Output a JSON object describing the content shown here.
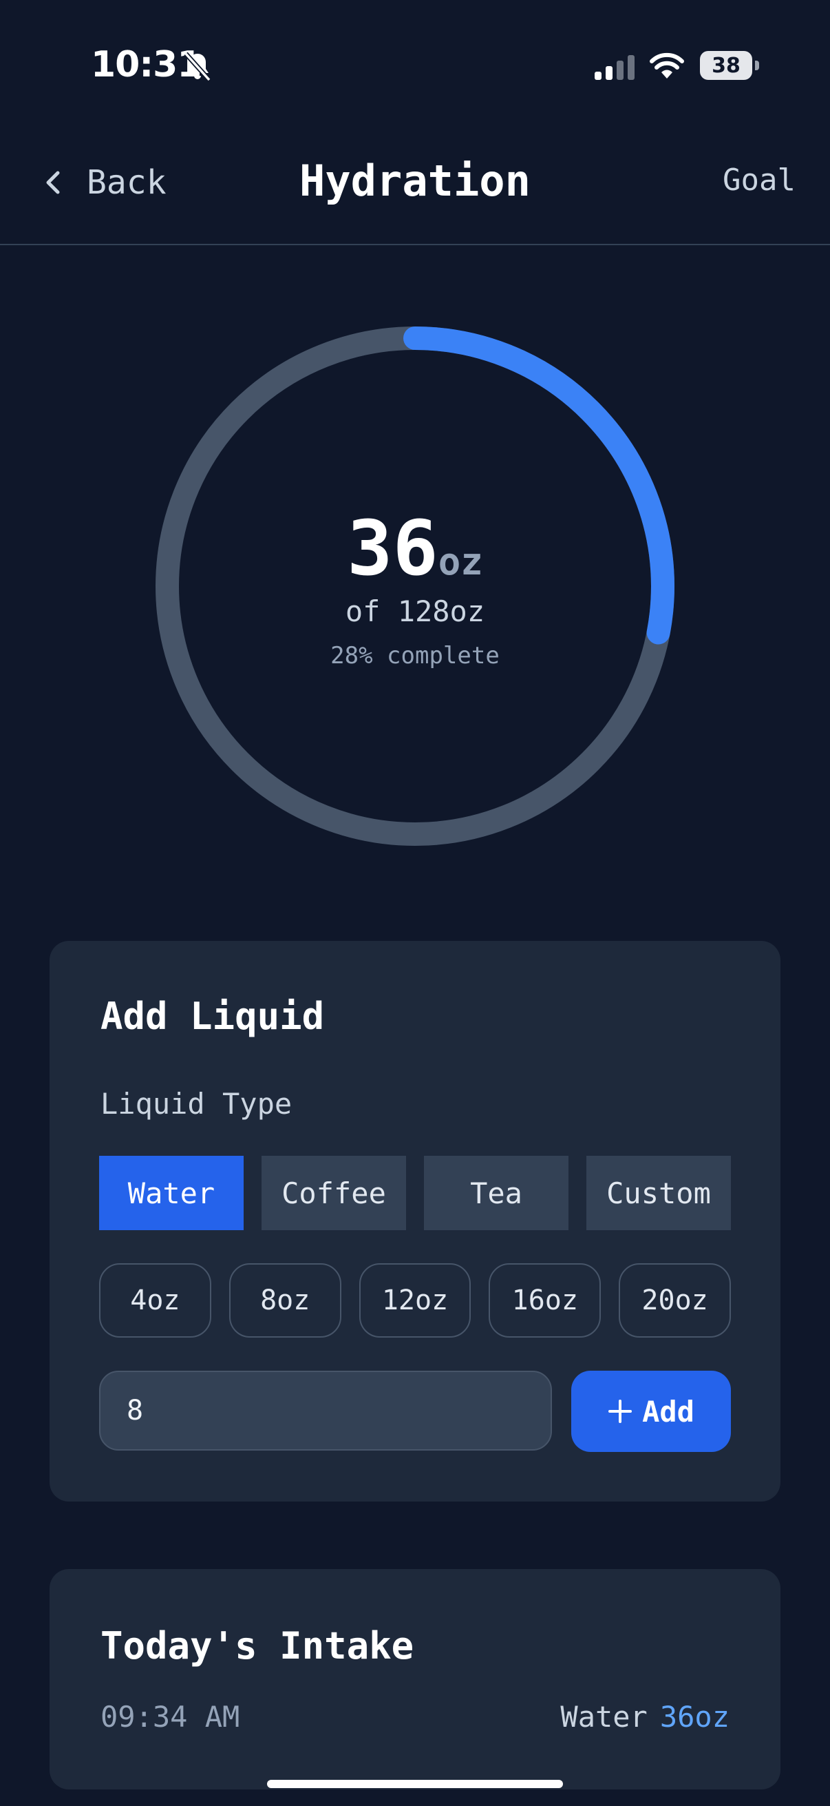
{
  "status_bar": {
    "time": "10:31",
    "battery": "38",
    "battery_level": 0.38,
    "icons": [
      "bell-slash-icon",
      "signal-icon",
      "wifi-icon",
      "battery-icon"
    ]
  },
  "nav": {
    "back_label": "Back",
    "title": "Hydration",
    "goal_label": "Goal"
  },
  "progress": {
    "current": "36",
    "unit": "oz",
    "goal_text": "of 128oz",
    "percent_text": "28% complete",
    "fraction": 0.28,
    "track_color": "#475569",
    "fill_color": "#3b82f6"
  },
  "add_liquid": {
    "title": "Add Liquid",
    "type_label": "Liquid Type",
    "types": [
      {
        "label": "Water",
        "active": true
      },
      {
        "label": "Coffee",
        "active": false
      },
      {
        "label": "Tea",
        "active": false
      },
      {
        "label": "Custom",
        "active": false
      }
    ],
    "amounts": [
      "4oz",
      "8oz",
      "12oz",
      "16oz",
      "20oz"
    ],
    "amount_value": "8",
    "add_label": "Add",
    "accent": "#2563eb"
  },
  "intake": {
    "title": "Today's Intake",
    "entries": [
      {
        "time": "09:34 AM",
        "type": "Water",
        "amount": "36oz"
      }
    ]
  }
}
